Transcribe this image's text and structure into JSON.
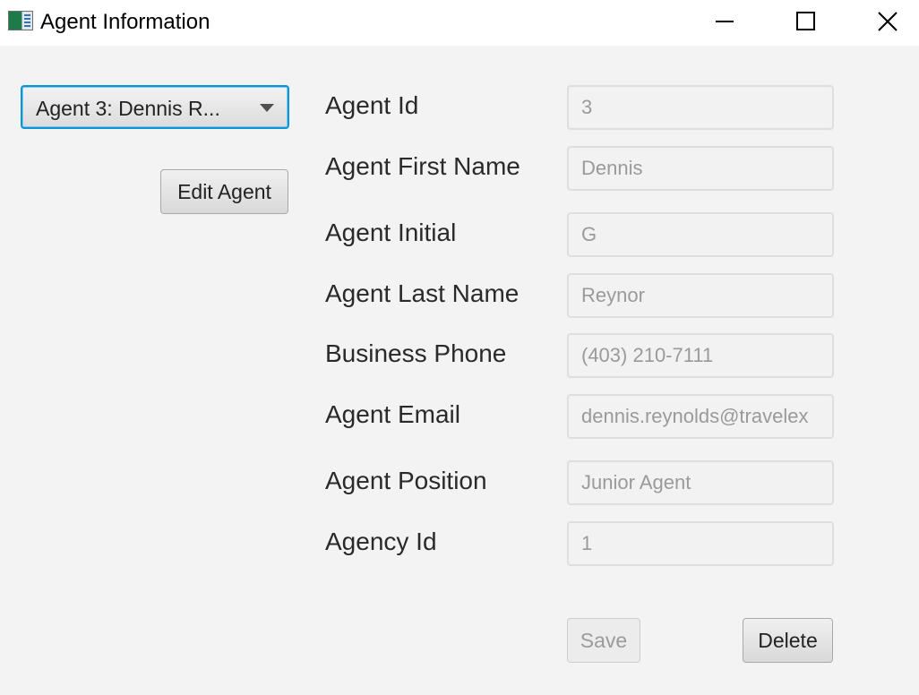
{
  "window": {
    "title": "Agent Information"
  },
  "agent_selector": {
    "value": "Agent 3: Dennis R..."
  },
  "buttons": {
    "edit": "Edit Agent",
    "save": "Save",
    "delete": "Delete"
  },
  "form": {
    "fields": [
      {
        "label": "Agent Id",
        "value": "3"
      },
      {
        "label": "Agent First Name",
        "value": "Dennis"
      },
      {
        "label": "Agent Initial",
        "value": "G"
      },
      {
        "label": "Agent Last Name",
        "value": "Reynor"
      },
      {
        "label": "Business Phone",
        "value": "(403) 210-7111"
      },
      {
        "label": "Agent Email",
        "value": "dennis.reynolds@travelex"
      },
      {
        "label": "Agent Position",
        "value": "Junior Agent"
      },
      {
        "label": "Agency Id",
        "value": "1"
      }
    ]
  },
  "colors": {
    "focus_border": "#0a96d6",
    "background": "#f3f3f3"
  }
}
